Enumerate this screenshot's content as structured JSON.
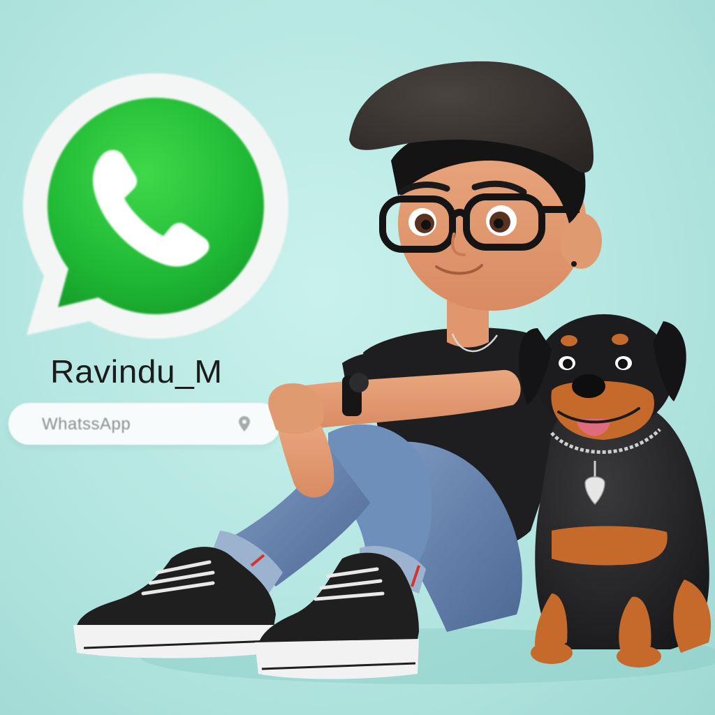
{
  "profile": {
    "username": "Ravindu_M",
    "app_label": "WhatssApp"
  },
  "colors": {
    "background": "#b4e6e1",
    "whatsapp_green": "#25c03b",
    "text_dark": "#1c1c1c"
  },
  "icons": {
    "logo": "whatsapp-logo-icon",
    "phone": "phone-handset-icon",
    "location": "location-pin-icon"
  }
}
